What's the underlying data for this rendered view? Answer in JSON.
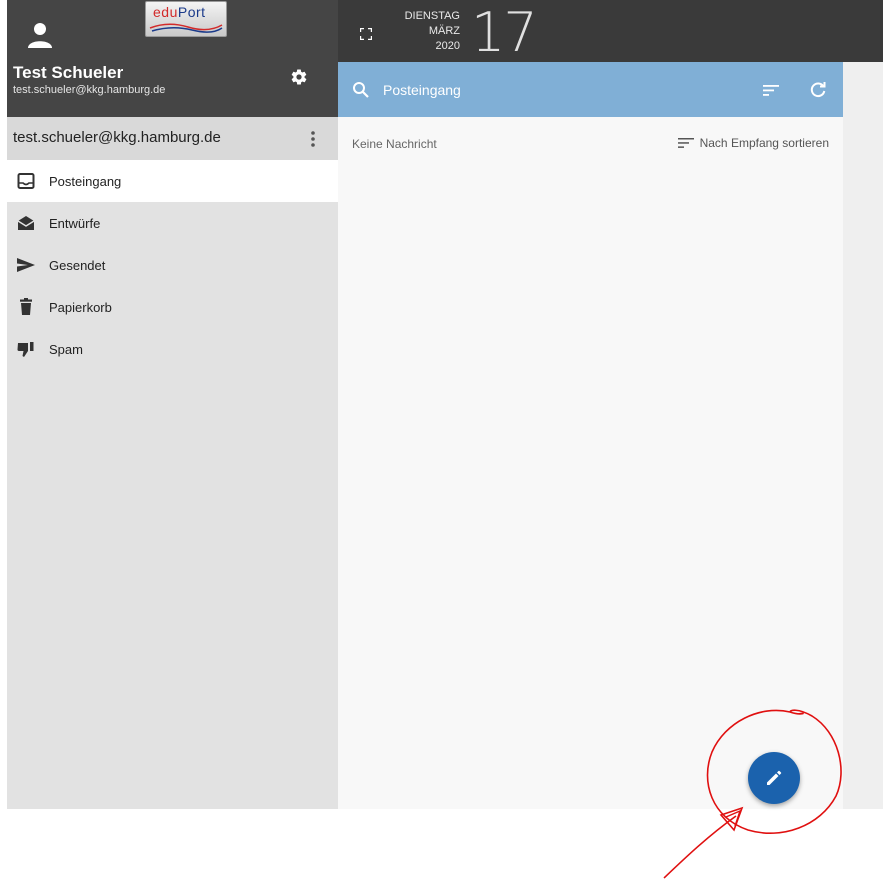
{
  "sidebar": {
    "logo": {
      "part1": "edu",
      "part2": "Port"
    },
    "user_name": "Test Schueler",
    "user_email": "test.schueler@kkg.hamburg.de",
    "account_email": "test.schueler@kkg.hamburg.de",
    "items": [
      {
        "label": "Posteingang",
        "icon": "inbox-icon",
        "active": true
      },
      {
        "label": "Entwürfe",
        "icon": "drafts-icon",
        "active": false
      },
      {
        "label": "Gesendet",
        "icon": "send-icon",
        "active": false
      },
      {
        "label": "Papierkorb",
        "icon": "trash-icon",
        "active": false
      },
      {
        "label": "Spam",
        "icon": "spam-icon",
        "active": false
      }
    ]
  },
  "header": {
    "weekday": "DIENSTAG",
    "month": "MÄRZ",
    "year": "2020",
    "day": "17"
  },
  "search": {
    "label": "Posteingang"
  },
  "content": {
    "empty_message": "Keine Nachricht",
    "sort_label": "Nach Empfang sortieren"
  },
  "colors": {
    "sidebar_header": "#454545",
    "topbar": "#3a3a3a",
    "search_bar": "#80afd6",
    "fab": "#1b62ad",
    "annotation": "#e01010"
  }
}
